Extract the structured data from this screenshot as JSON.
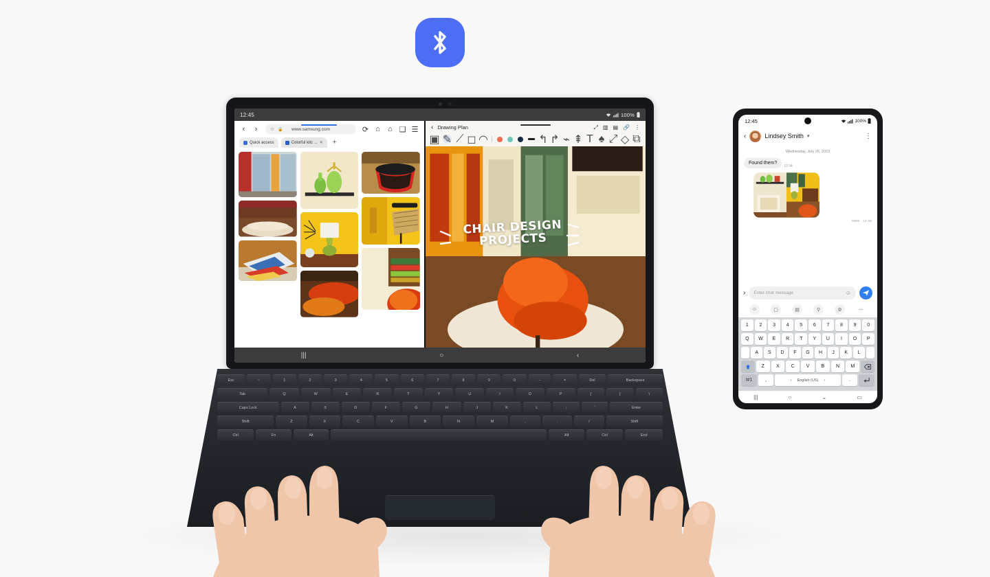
{
  "badge": {
    "name": "bluetooth-icon",
    "label": "Bluetooth",
    "color": "#4c6ef5"
  },
  "tablet": {
    "statusbar": {
      "time": "12:45",
      "battery": "100%",
      "wifi_icon": "wifi-icon",
      "signal_icon": "signal-icon",
      "battery_icon": "battery-icon"
    },
    "browser": {
      "url": "www.samsung.com",
      "back_icon": "back-chevron-icon",
      "forward_icon": "forward-chevron-icon",
      "star_icon": "star-icon",
      "lock_icon": "lock-icon",
      "refresh_icon": "refresh-icon",
      "download_icon": "download-icon",
      "home_icon": "home-icon",
      "tabs_icon": "tabs-icon",
      "menu_icon": "menu-icon",
      "tabs": [
        {
          "label": "Quick access",
          "closable": false
        },
        {
          "label": "Colorful kitc ...",
          "closable": true
        }
      ],
      "new_tab_label": "+"
    },
    "note": {
      "title": "Drawing Plan",
      "back_icon": "back-chevron-icon",
      "header_icons": [
        "expand-icon",
        "page-view-icon",
        "save-icon",
        "attach-icon",
        "more-vertical-icon"
      ],
      "tools": [
        "image-icon",
        "pen-icon",
        "highlighter-icon",
        "eraser-icon",
        "shape-icon"
      ],
      "colors": [
        "#ef6c53",
        "#6ec6b8",
        "#132b45"
      ],
      "extra_tools": [
        "line-width-icon",
        "undo-icon",
        "redo-icon",
        "lasso-icon",
        "text-convert-icon",
        "text-icon",
        "ink-icon",
        "transform-icon",
        "color-picker-icon",
        "copy-icon"
      ],
      "canvas_text_line1": "CHAIR DESIGN",
      "canvas_text_line2": "PROJECTS"
    },
    "navbar": {
      "recents": "recents-icon",
      "home": "home-icon",
      "back": "back-icon"
    },
    "keyboard_rows": [
      [
        "Esc",
        "~",
        "!",
        "@",
        "#",
        "$",
        "%",
        "^",
        "&",
        "*",
        "(",
        ")",
        "_",
        "+",
        "Del",
        "Backspace"
      ],
      [
        "Tab",
        "Q",
        "W",
        "E",
        "R",
        "T",
        "Y",
        "U",
        "I",
        "O",
        "P",
        "{",
        "}",
        "|"
      ],
      [
        "Caps Lock",
        "A",
        "S",
        "D",
        "F",
        "G",
        "H",
        "J",
        "K",
        "L",
        ":",
        "\"",
        "Enter"
      ],
      [
        "Shift",
        "Z",
        "X",
        "C",
        "V",
        "B",
        "N",
        "M",
        "<",
        ">",
        "?",
        "Shift"
      ],
      [
        "Ctrl",
        "Fn",
        "Alt",
        "",
        "Alt",
        "Ctrl",
        "End"
      ]
    ]
  },
  "phone": {
    "statusbar": {
      "time": "12:45",
      "battery": "100%"
    },
    "appbar": {
      "contact_name": "Lindsey Smith",
      "back_icon": "back-chevron-icon",
      "chevron_icon": "chevron-down-icon",
      "menu_icon": "more-vertical-icon",
      "avatar": "contact-avatar"
    },
    "conversation": {
      "date_divider": "Wednesday, July 26, 2023",
      "messages": [
        {
          "type": "text",
          "text": "Found them?",
          "time": "12:34",
          "from": "them"
        },
        {
          "type": "image",
          "label": "MMS",
          "time": "12:40",
          "from": "them"
        }
      ]
    },
    "input": {
      "placeholder": "Enter chat message",
      "expand_icon": "expand-chevron-icon",
      "emoji_icon": "emoji-icon",
      "send_icon": "send-icon"
    },
    "toolrow": [
      "emoji-icon",
      "clipboard-icon",
      "sticker-icon",
      "mic-icon",
      "settings-icon",
      "more-icon"
    ],
    "keyboard": {
      "row_numbers": [
        "1",
        "2",
        "3",
        "4",
        "5",
        "6",
        "7",
        "8",
        "9",
        "0"
      ],
      "row_q": [
        "Q",
        "W",
        "E",
        "R",
        "T",
        "Y",
        "U",
        "I",
        "O",
        "P"
      ],
      "row_a": [
        "A",
        "S",
        "D",
        "F",
        "G",
        "H",
        "J",
        "K",
        "L"
      ],
      "row_z": [
        "Z",
        "X",
        "C",
        "V",
        "B",
        "N",
        "M"
      ],
      "shift_label": "shift-icon",
      "backspace_label": "backspace-icon",
      "sym_label": "!#1",
      "comma_label": ",",
      "space_label": "English (US)",
      "space_prev": "‹",
      "space_next": "›",
      "period_label": ".",
      "enter_label": "enter-icon"
    },
    "navbar": {
      "recents": "recents-icon",
      "home": "home-icon",
      "hide_keyboard": "chevron-down-icon",
      "keyboard": "keyboard-icon"
    }
  }
}
